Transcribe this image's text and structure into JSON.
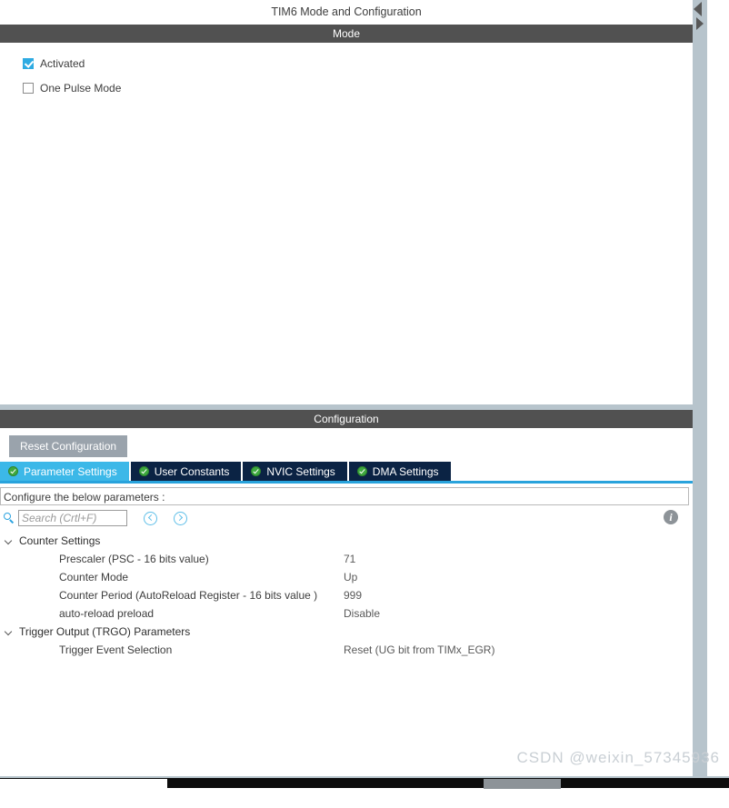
{
  "window": {
    "title": "TIM6 Mode and Configuration"
  },
  "mode_section": {
    "header": "Mode",
    "checkboxes": [
      {
        "label": "Activated",
        "checked": true
      },
      {
        "label": "One Pulse Mode",
        "checked": false
      }
    ]
  },
  "configuration_section": {
    "header": "Configuration",
    "reset_button": "Reset Configuration",
    "tabs": [
      {
        "label": "Parameter Settings",
        "active": true,
        "icon": "green-check-icon"
      },
      {
        "label": "User Constants",
        "active": false,
        "icon": "green-check-icon"
      },
      {
        "label": "NVIC Settings",
        "active": false,
        "icon": "green-check-icon"
      },
      {
        "label": "DMA Settings",
        "active": false,
        "icon": "green-check-icon"
      }
    ],
    "configure_note": "Configure the below parameters :",
    "search": {
      "placeholder": "Search (Crtl+F)",
      "value": "",
      "icon": "search-icon",
      "prev_icon": "chevron-left-circle-icon",
      "next_icon": "chevron-right-circle-icon"
    },
    "info_icon_label": "i",
    "parameter_groups": [
      {
        "name": "Counter Settings",
        "expanded": true,
        "rows": [
          {
            "name": "Prescaler (PSC - 16 bits value)",
            "value": "71"
          },
          {
            "name": "Counter Mode",
            "value": "Up"
          },
          {
            "name": "Counter Period (AutoReload Register - 16 bits value )",
            "value": "999"
          },
          {
            "name": "auto-reload preload",
            "value": "Disable"
          }
        ]
      },
      {
        "name": "Trigger Output (TRGO) Parameters",
        "expanded": true,
        "rows": [
          {
            "name": "Trigger Event Selection",
            "value": "Reset (UG bit from TIMx_EGR)"
          }
        ]
      }
    ]
  },
  "watermark": "CSDN @weixin_57345936",
  "colors": {
    "section_header_bg": "#515151",
    "active_tab_bg": "#3cb8e8",
    "inactive_tab_bg": "#0b2344",
    "tab_underline": "#29a3dc",
    "accent_blue": "#2eabe2",
    "reset_button_bg": "#9aa3ac",
    "splitter": "#b7c4cc",
    "check_green": "#3fa93f"
  }
}
